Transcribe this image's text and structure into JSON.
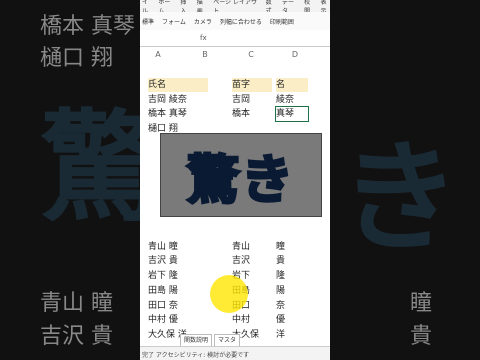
{
  "background": {
    "left_top_name": "橋本 真琴",
    "left_row2": "樋口 翔",
    "left_bottom_1": "青山 瞳",
    "left_bottom_2": "吉沢 貴",
    "right_bottom_1": "瞳",
    "right_bottom_2": "貴",
    "left_deco": "驚",
    "right_deco": "き"
  },
  "ribbon": {
    "tabs": [
      "イル",
      "ホーム",
      "挿入",
      "描画",
      "ページ レイアウト",
      "数式",
      "データ",
      "校閲",
      "表示"
    ]
  },
  "toolbar": {
    "items": [
      "標準",
      "フォーム",
      "カメラ",
      "列幅に合わせる",
      "印刷範囲"
    ]
  },
  "formula_bar": {
    "fx": "fx"
  },
  "columns": [
    "A",
    "B",
    "C",
    "D"
  ],
  "table": {
    "headers": [
      "氏名",
      "苗字",
      "名"
    ],
    "rows": [
      [
        "吉岡 綾奈",
        "吉岡",
        "綾奈"
      ],
      [
        "橋本 真琴",
        "橋本",
        "真琴"
      ],
      [
        "樋口 翔",
        "",
        ""
      ],
      [
        "",
        "",
        ""
      ],
      [
        "",
        "",
        ""
      ],
      [
        "",
        "",
        ""
      ],
      [
        "",
        "",
        ""
      ],
      [
        "",
        "",
        ""
      ],
      [
        "",
        "",
        ""
      ],
      [
        "",
        "",
        ""
      ],
      [
        "青山 瞳",
        "青山",
        "瞳"
      ],
      [
        "吉沢 貴",
        "吉沢",
        "貴"
      ],
      [
        "岩下 隆",
        "岩下",
        "隆"
      ],
      [
        "田島 陽",
        "田島",
        "陽"
      ],
      [
        "田口 奈",
        "田口",
        "奈"
      ],
      [
        "中村 優",
        "中村",
        "優"
      ],
      [
        "大久保 洋",
        "大久保",
        "洋"
      ]
    ]
  },
  "overlay": {
    "text": "驚き"
  },
  "sheets": [
    "関数説明",
    "マスタ"
  ],
  "status": {
    "text": "完了  アクセシビリティ: 検討が必要です"
  },
  "colors": {
    "header_fill": "#fbeec6",
    "selection": "#1e7145",
    "highlight": "#ffe600",
    "overlay_text": "#4fb8ff"
  }
}
